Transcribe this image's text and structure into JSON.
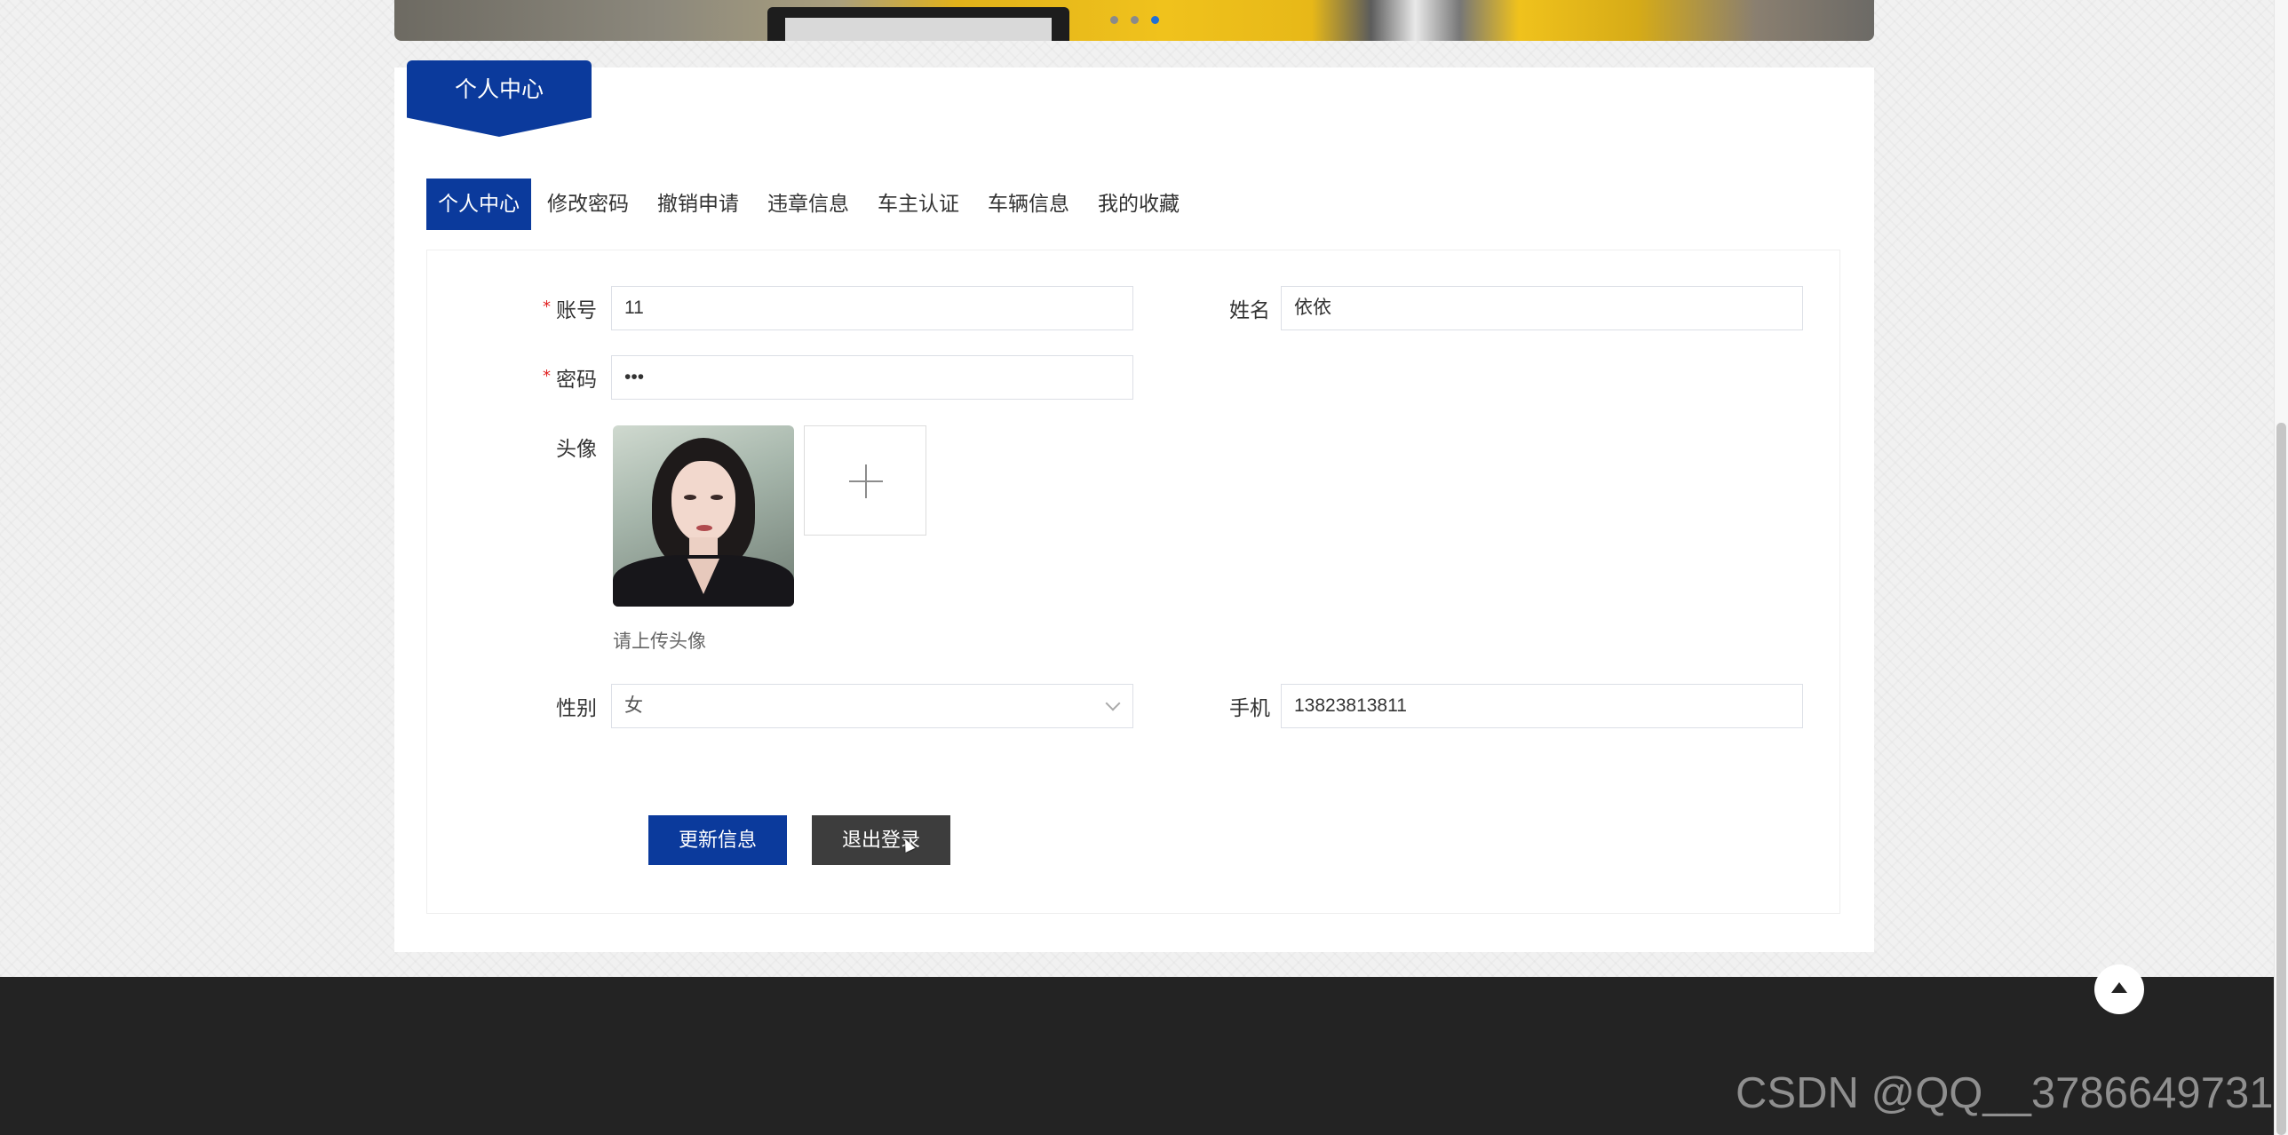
{
  "banner": {
    "slide_count": 3,
    "active_slide": 3
  },
  "section_title": "个人中心",
  "tabs": [
    {
      "label": "个人中心",
      "active": true
    },
    {
      "label": "修改密码",
      "active": false
    },
    {
      "label": "撤销申请",
      "active": false
    },
    {
      "label": "违章信息",
      "active": false
    },
    {
      "label": "车主认证",
      "active": false
    },
    {
      "label": "车辆信息",
      "active": false
    },
    {
      "label": "我的收藏",
      "active": false
    }
  ],
  "form": {
    "required_mark": "*",
    "account": {
      "label": "账号",
      "value": "11"
    },
    "name": {
      "label": "姓名",
      "value": "依依"
    },
    "password": {
      "label": "密码",
      "value": "•••"
    },
    "avatar": {
      "label": "头像",
      "hint": "请上传头像"
    },
    "gender": {
      "label": "性别",
      "value": "女"
    },
    "phone": {
      "label": "手机",
      "value": "13823813811"
    }
  },
  "buttons": {
    "update": "更新信息",
    "logout": "退出登录"
  },
  "watermark": "CSDN @QQ__3786649731",
  "colors": {
    "primary": "#0b3a9c",
    "dark_button": "#3d3d3d",
    "footer": "#232323",
    "required": "#e02020"
  }
}
